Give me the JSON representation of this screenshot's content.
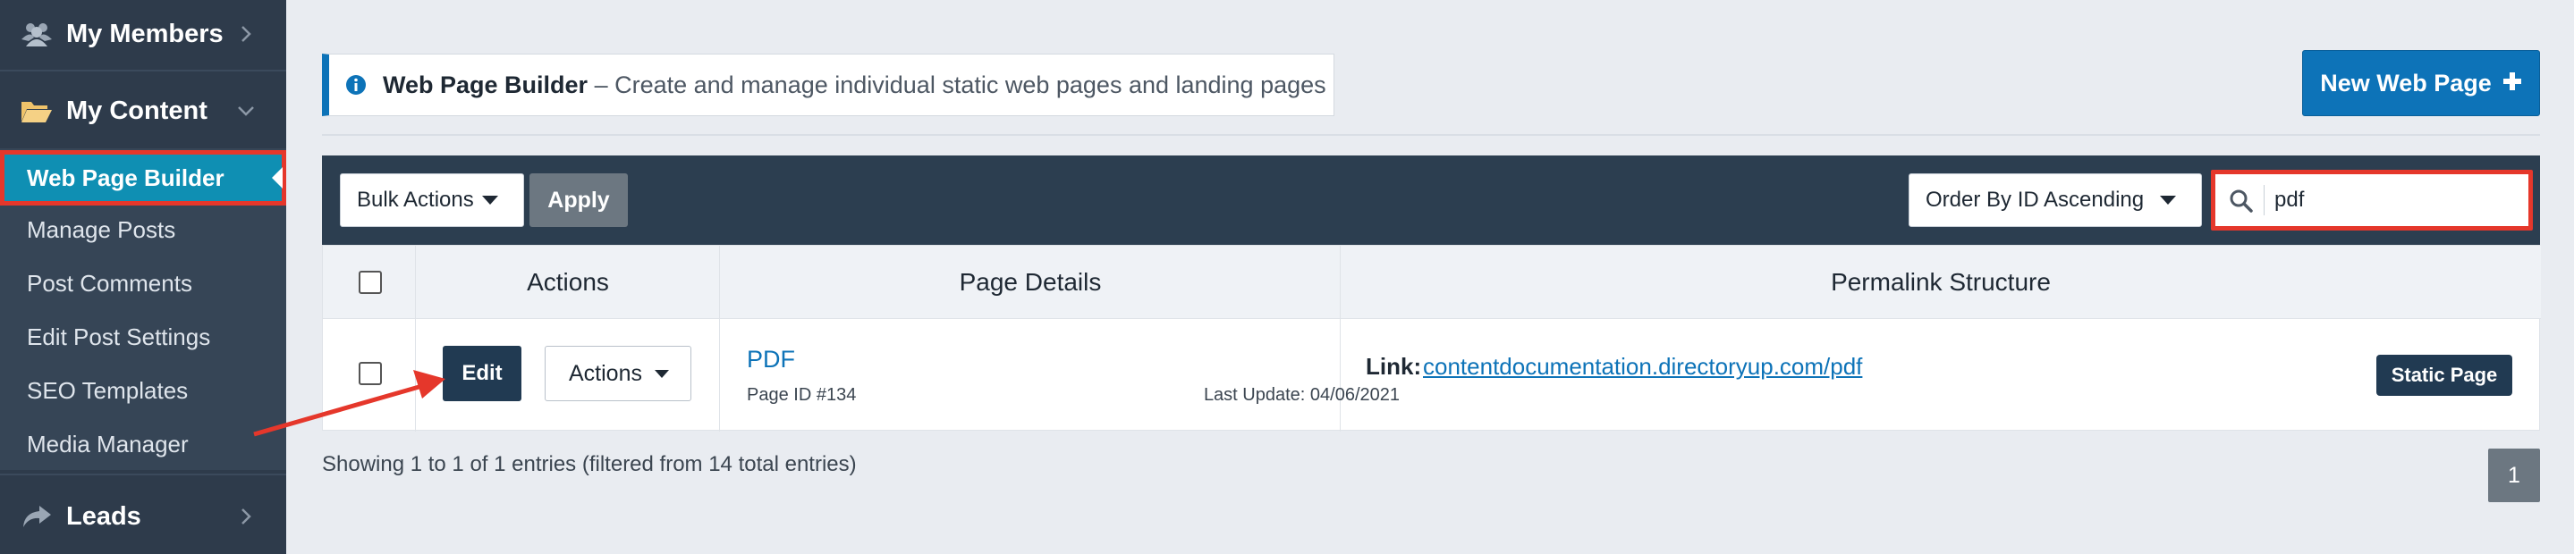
{
  "sidebar": {
    "sections": {
      "members": {
        "label": "My Members",
        "icon": "users-icon"
      },
      "content": {
        "label": "My Content",
        "icon": "folder-open-icon"
      },
      "leads": {
        "label": "Leads",
        "icon": "share-icon"
      }
    },
    "items": [
      {
        "label": "Web Page Builder",
        "active": true
      },
      {
        "label": "Manage Posts"
      },
      {
        "label": "Post Comments"
      },
      {
        "label": "Edit Post Settings"
      },
      {
        "label": "SEO Templates"
      },
      {
        "label": "Media Manager"
      }
    ]
  },
  "header": {
    "info_icon": "info-circle-icon",
    "title": "Web Page Builder",
    "description": " – Create and manage individual static web pages and landing pages",
    "new_button": "New Web Page"
  },
  "toolbar": {
    "bulk_actions": "Bulk Actions",
    "apply": "Apply",
    "order_by": "Order By ID Ascending",
    "search_value": "pdf"
  },
  "table": {
    "columns": {
      "actions": "Actions",
      "details": "Page Details",
      "permalink": "Permalink Structure"
    },
    "rows": [
      {
        "edit": "Edit",
        "actions": "Actions",
        "title": "PDF",
        "page_id": "Page ID #134",
        "last_update": "Last Update: 04/06/2021",
        "link_label": "Link:",
        "link_url": "contentdocumentation.directoryup.com/pdf",
        "badge": "Static Page"
      }
    ]
  },
  "footer": {
    "entries_info": "Showing 1 to 1 of 1 entries (filtered from 14 total entries)",
    "current_page": "1"
  },
  "colors": {
    "sidebar_bg": "#2e3b4b",
    "active_item": "#0f8fb3",
    "highlight": "#e5372b",
    "primary": "#0d73b8",
    "toolbar_bg": "#2c3e50"
  }
}
